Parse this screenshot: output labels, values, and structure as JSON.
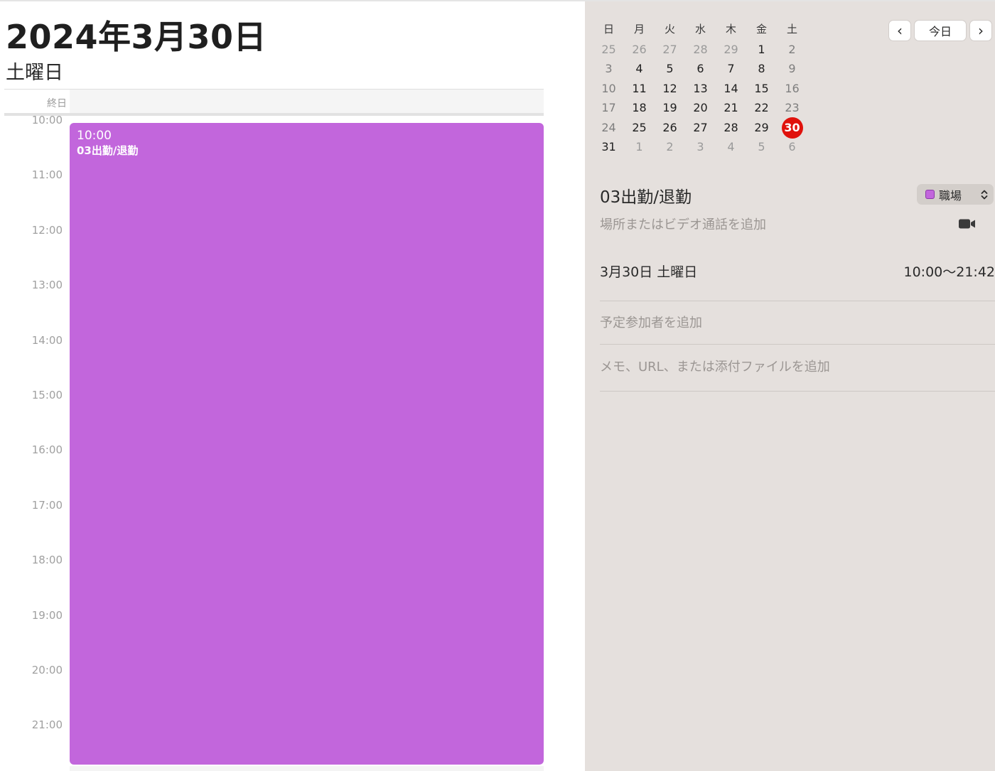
{
  "day_view": {
    "date_title": "2024年3月30日",
    "weekday": "土曜日",
    "all_day_label": "終日",
    "hours": [
      "10:00",
      "11:00",
      "12:00",
      "13:00",
      "14:00",
      "15:00",
      "16:00",
      "17:00",
      "18:00",
      "19:00",
      "20:00",
      "21:00"
    ],
    "event": {
      "start_time": "10:00",
      "title": "03出勤/退勤",
      "color": "#c266dc"
    }
  },
  "mini_calendar": {
    "weekday_headers": [
      "日",
      "月",
      "火",
      "水",
      "木",
      "金",
      "土"
    ],
    "weeks": [
      [
        {
          "d": "25",
          "s": "dim"
        },
        {
          "d": "26",
          "s": "dim"
        },
        {
          "d": "27",
          "s": "dim"
        },
        {
          "d": "28",
          "s": "dim"
        },
        {
          "d": "29",
          "s": "dim"
        },
        {
          "d": "1",
          "s": "cur"
        },
        {
          "d": "2",
          "s": "weekend"
        }
      ],
      [
        {
          "d": "3",
          "s": "weekend"
        },
        {
          "d": "4",
          "s": "cur"
        },
        {
          "d": "5",
          "s": "cur"
        },
        {
          "d": "6",
          "s": "cur"
        },
        {
          "d": "7",
          "s": "cur"
        },
        {
          "d": "8",
          "s": "cur"
        },
        {
          "d": "9",
          "s": "weekend"
        }
      ],
      [
        {
          "d": "10",
          "s": "weekend"
        },
        {
          "d": "11",
          "s": "cur"
        },
        {
          "d": "12",
          "s": "cur"
        },
        {
          "d": "13",
          "s": "cur"
        },
        {
          "d": "14",
          "s": "cur"
        },
        {
          "d": "15",
          "s": "cur"
        },
        {
          "d": "16",
          "s": "weekend"
        }
      ],
      [
        {
          "d": "17",
          "s": "weekend"
        },
        {
          "d": "18",
          "s": "cur"
        },
        {
          "d": "19",
          "s": "cur"
        },
        {
          "d": "20",
          "s": "cur"
        },
        {
          "d": "21",
          "s": "cur"
        },
        {
          "d": "22",
          "s": "cur"
        },
        {
          "d": "23",
          "s": "weekend"
        }
      ],
      [
        {
          "d": "24",
          "s": "weekend"
        },
        {
          "d": "25",
          "s": "cur"
        },
        {
          "d": "26",
          "s": "cur"
        },
        {
          "d": "27",
          "s": "cur"
        },
        {
          "d": "28",
          "s": "cur"
        },
        {
          "d": "29",
          "s": "cur"
        },
        {
          "d": "30",
          "s": "today"
        }
      ],
      [
        {
          "d": "31",
          "s": "cur"
        },
        {
          "d": "1",
          "s": "dim"
        },
        {
          "d": "2",
          "s": "dim"
        },
        {
          "d": "3",
          "s": "dim"
        },
        {
          "d": "4",
          "s": "dim"
        },
        {
          "d": "5",
          "s": "dim"
        },
        {
          "d": "6",
          "s": "dim"
        }
      ]
    ],
    "today_color": "#e0120c"
  },
  "nav": {
    "prev_icon": "chevron-left-icon",
    "prev_glyph": "‹",
    "today_label": "今日",
    "next_icon": "chevron-right-icon",
    "next_glyph": "›"
  },
  "inspector": {
    "title": "03出勤/退勤",
    "calendar_name": "職場",
    "calendar_color": "#c266dc",
    "location_placeholder": "場所またはビデオ通話を追加",
    "video_icon": "video-camera-icon",
    "date": "3月30日 土曜日",
    "time_range": "10:00～21:42",
    "attendees_placeholder": "予定参加者を追加",
    "notes_placeholder": "メモ、URL、または添付ファイルを追加"
  }
}
